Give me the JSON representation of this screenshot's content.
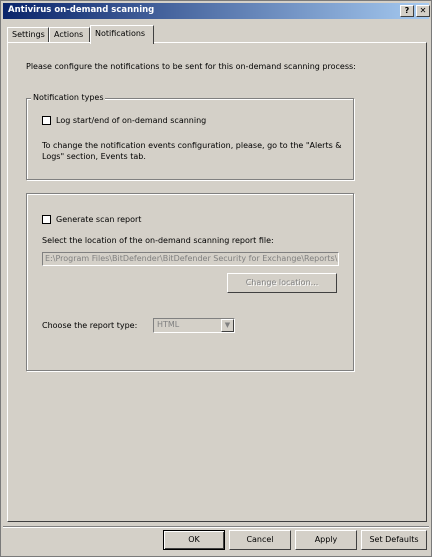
{
  "window": {
    "title": "Antivirus on-demand scanning",
    "help_glyph": "?",
    "close_glyph": "✕"
  },
  "tabs": [
    {
      "label": "Settings"
    },
    {
      "label": "Actions"
    },
    {
      "label": "Notifications"
    }
  ],
  "active_tab": "Notifications",
  "intro_text": "Please configure the notifications to  be sent for this on-demand scanning process:",
  "notification_types": {
    "legend": "Notification types",
    "log_checkbox_label": "Log start/end of on-demand scanning",
    "log_checked": false,
    "note": "To change the notification events configuration, please, go to the \"Alerts & Logs\" section, Events tab."
  },
  "report": {
    "generate_label": "Generate scan report",
    "generate_checked": false,
    "location_label": "Select the location of the on-demand scanning report file:",
    "location_value": "E:\\Program Files\\BitDefender\\BitDefender Security for Exchange\\Reports\\",
    "change_location_label": "Change location...",
    "report_type_label": "Choose the report type:",
    "report_type_value": "HTML"
  },
  "buttons": {
    "ok": "OK",
    "cancel": "Cancel",
    "apply": "Apply",
    "set_defaults": "Set Defaults"
  },
  "colors": {
    "title_start": "#0a246a",
    "title_end": "#a6caf0",
    "face": "#d4d0c8"
  }
}
